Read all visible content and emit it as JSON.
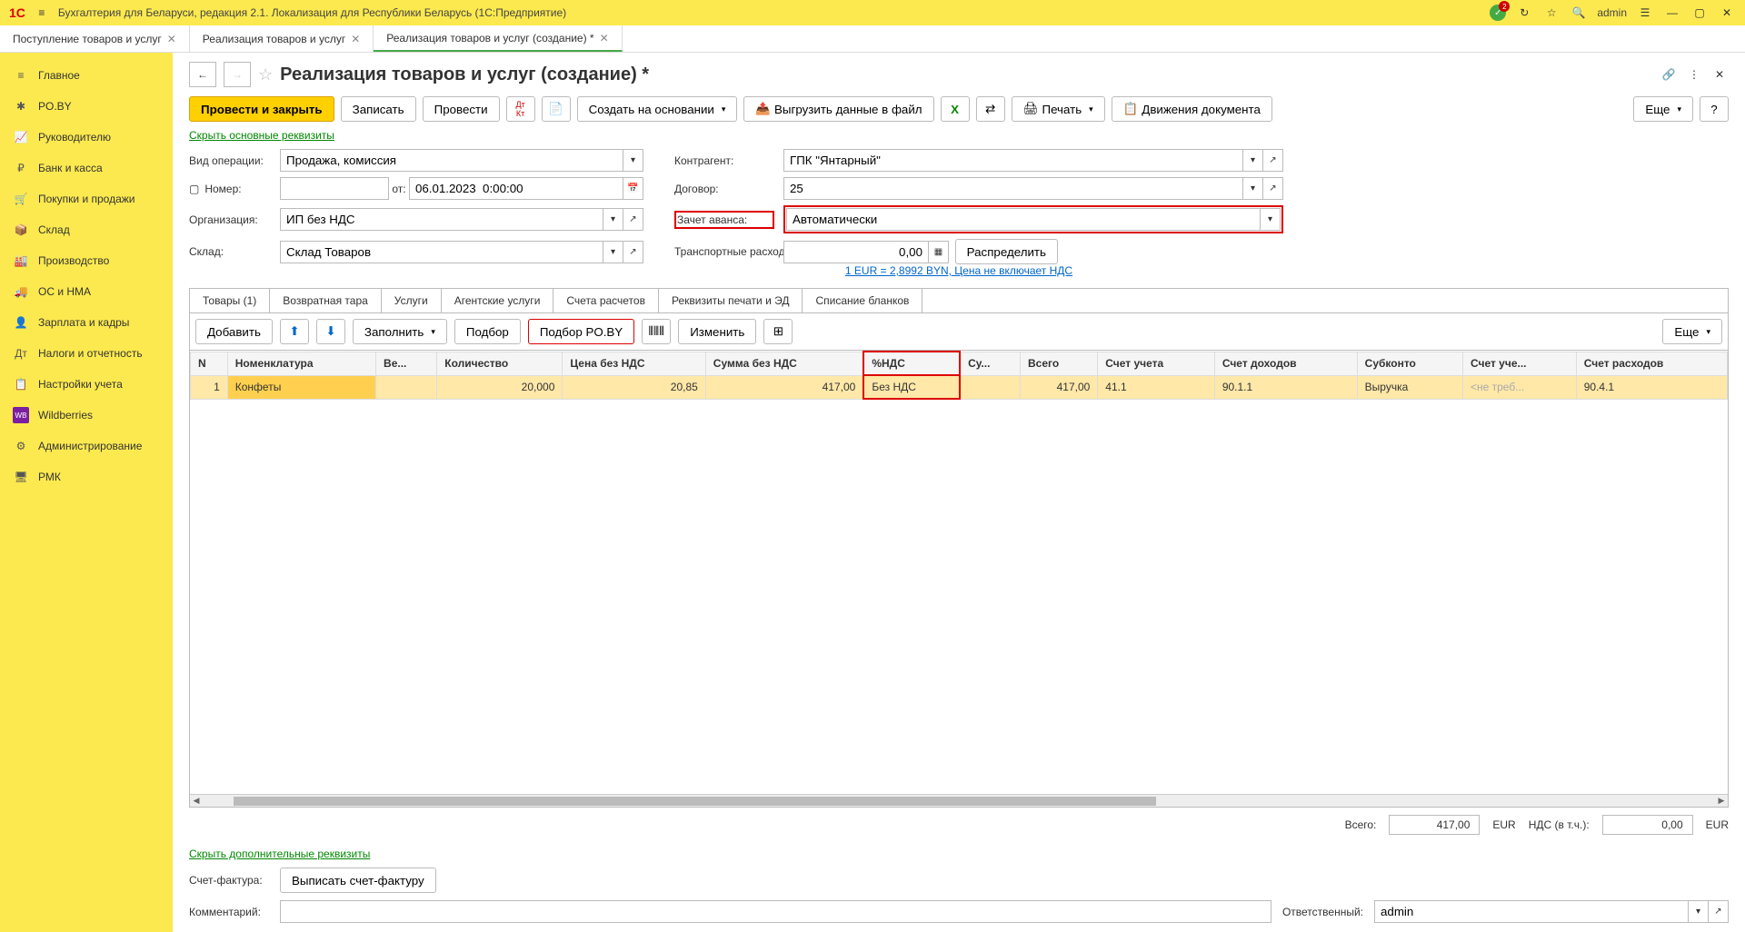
{
  "titlebar": {
    "app_title": "Бухгалтерия для Беларуси, редакция 2.1. Локализация для Республики Беларусь   (1С:Предприятие)",
    "user": "admin",
    "notification_count": "2"
  },
  "nav_tabs": [
    {
      "label": "Поступление товаров и услуг",
      "active": false
    },
    {
      "label": "Реализация товаров и услуг",
      "active": false
    },
    {
      "label": "Реализация товаров и услуг (создание) *",
      "active": true
    }
  ],
  "sidebar": [
    {
      "label": "Главное",
      "icon": "≡"
    },
    {
      "label": "PO.BY",
      "icon": "✱"
    },
    {
      "label": "Руководителю",
      "icon": "📈"
    },
    {
      "label": "Банк и касса",
      "icon": "₽"
    },
    {
      "label": "Покупки и продажи",
      "icon": "🛒"
    },
    {
      "label": "Склад",
      "icon": "📦"
    },
    {
      "label": "Производство",
      "icon": "🏭"
    },
    {
      "label": "ОС и НМА",
      "icon": "🚚"
    },
    {
      "label": "Зарплата и кадры",
      "icon": "👤"
    },
    {
      "label": "Налоги и отчетность",
      "icon": "Дт"
    },
    {
      "label": "Настройки учета",
      "icon": "📋"
    },
    {
      "label": "Wildberries",
      "icon": "WB"
    },
    {
      "label": "Администрирование",
      "icon": "⚙"
    },
    {
      "label": "РМК",
      "icon": "🖥"
    }
  ],
  "page": {
    "title": "Реализация товаров и услуг (создание) *"
  },
  "toolbar": {
    "conduct_close": "Провести и закрыть",
    "save": "Записать",
    "conduct": "Провести",
    "create_based": "Создать на основании",
    "export": "Выгрузить данные в файл",
    "print": "Печать",
    "movements": "Движения документа",
    "more": "Еще"
  },
  "links": {
    "hide_main": "Скрыть основные реквизиты",
    "currency": "1 EUR = 2,8992 BYN, Цена не включает НДС",
    "hide_additional": "Скрыть дополнительные реквизиты"
  },
  "form": {
    "op_type_label": "Вид операции:",
    "op_type": "Продажа, комиссия",
    "number_label": "Номер:",
    "number": "",
    "from": "от:",
    "date": "06.01.2023  0:00:00",
    "org_label": "Организация:",
    "org": "ИП без НДС",
    "warehouse_label": "Склад:",
    "warehouse": "Склад Товаров",
    "contr_label": "Контрагент:",
    "contr": "ГПК \"Янтарный\"",
    "contract_label": "Договор:",
    "contract": "25",
    "advance_label": "Зачет аванса:",
    "advance": "Автоматически",
    "transport_label": "Транспортные расходы:",
    "transport": "0,00",
    "distribute": "Распределить"
  },
  "doc_tabs": [
    "Товары (1)",
    "Возвратная тара",
    "Услуги",
    "Агентские услуги",
    "Счета расчетов",
    "Реквизиты печати и ЭД",
    "Списание бланков"
  ],
  "table_toolbar": {
    "add": "Добавить",
    "fill": "Заполнить",
    "pick": "Подбор",
    "pick_poby": "Подбор PO.BY",
    "change": "Изменить",
    "more": "Еще"
  },
  "columns": [
    "N",
    "Номенклатура",
    "Ве...",
    "Количество",
    "Цена без НДС",
    "Сумма без НДС",
    "%НДС",
    "Су...",
    "Всего",
    "Счет учета",
    "Счет доходов",
    "Субконто",
    "Счет уче...",
    "Счет расходов"
  ],
  "rows": [
    {
      "n": "1",
      "nom": "Конфеты",
      "we": "",
      "qty": "20,000",
      "price": "20,85",
      "sum": "417,00",
      "vat": "Без НДС",
      "su": "",
      "total": "417,00",
      "acct": "41.1",
      "income": "90.1.1",
      "sub": "Выручка",
      "acct2": "<не треб...",
      "exp": "90.4.1"
    }
  ],
  "totals": {
    "total_label": "Всего:",
    "total_val": "417,00",
    "total_cur": "EUR",
    "vat_label": "НДС (в т.ч.):",
    "vat_val": "0,00",
    "vat_cur": "EUR"
  },
  "footer": {
    "invoice_label": "Счет-фактура:",
    "invoice_btn": "Выписать счет-фактуру",
    "comment_label": "Комментарий:",
    "comment": "",
    "resp_label": "Ответственный:",
    "resp": "admin"
  }
}
